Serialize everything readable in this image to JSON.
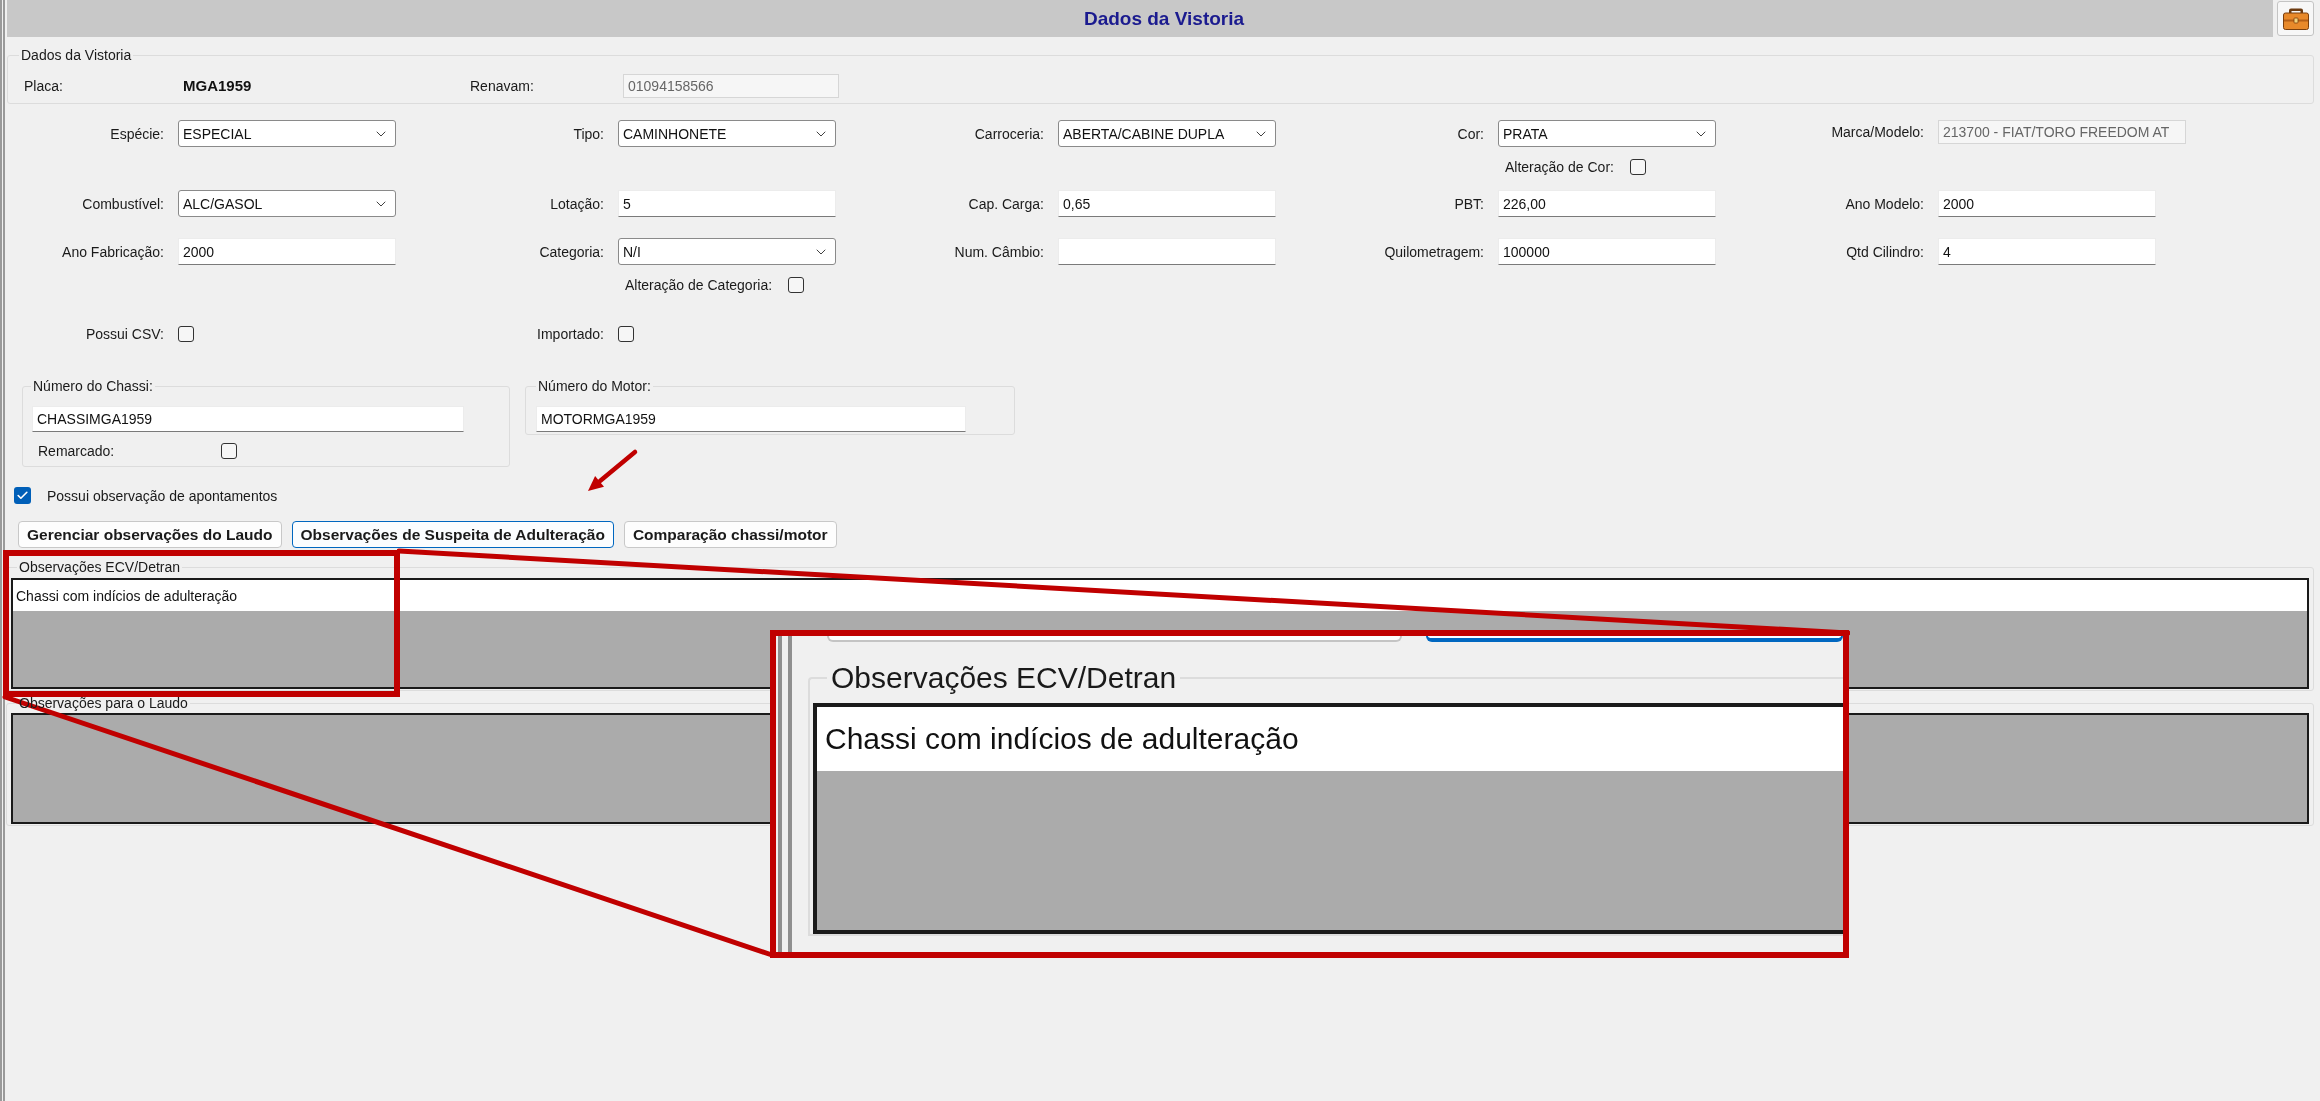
{
  "header": {
    "title": "Dados da Vistoria"
  },
  "vistoria": {
    "legend": "Dados da Vistoria",
    "placa": {
      "label": "Placa:",
      "value": "MGA1959"
    },
    "renavam": {
      "label": "Renavam:",
      "kind": "readonly",
      "value": "01094158566"
    }
  },
  "rows": [
    {
      "cells": [
        {
          "kind": "combo",
          "label": "Espécie:",
          "value": "ESPECIAL"
        },
        {
          "kind": "combo",
          "label": "Tipo:",
          "value": "CAMINHONETE"
        },
        {
          "kind": "combo",
          "label": "Carroceria:",
          "value": "ABERTA/CABINE DUPLA"
        },
        {
          "kind": "combo",
          "label": "Cor:",
          "value": "PRATA",
          "option": {
            "label": "Alteração de Cor:",
            "checked": false
          }
        },
        {
          "kind": "readonly",
          "label": "Marca/Modelo:",
          "value": "213700 - FIAT/TORO FREEDOM AT"
        }
      ]
    },
    {
      "cells": [
        {
          "kind": "combo",
          "label": "Combustível:",
          "value": "ALC/GASOL"
        },
        {
          "kind": "text",
          "label": "Lotação:",
          "value": "5"
        },
        {
          "kind": "text",
          "label": "Cap. Carga:",
          "value": "0,65"
        },
        {
          "kind": "text",
          "label": "PBT:",
          "value": "226,00"
        },
        {
          "kind": "text",
          "label": "Ano Modelo:",
          "value": "2000"
        }
      ]
    },
    {
      "cells": [
        {
          "kind": "text",
          "label": "Ano Fabricação:",
          "value": "2000"
        },
        {
          "kind": "combo",
          "label": "Categoria:",
          "value": "N/I",
          "option": {
            "label": "Alteração de Categoria:",
            "checked": false
          }
        },
        {
          "kind": "text",
          "label": "Num. Câmbio:"
        },
        {
          "kind": "text",
          "label": "Quilometragem:",
          "value": "100000"
        },
        {
          "kind": "text",
          "label": "Qtd Cilindro:",
          "value": "4"
        }
      ]
    },
    {
      "cells": [
        {
          "kind": "checkbox",
          "label": "Possui CSV:",
          "checked": false
        },
        {
          "kind": "checkbox",
          "label": "Importado:",
          "checked": false
        }
      ]
    }
  ],
  "chassi": {
    "legend": "Número do Chassi:",
    "value": "CHASSIMGA1959",
    "option": {
      "label": "Remarcado:",
      "checked": false
    }
  },
  "motor": {
    "legend": "Número do Motor:",
    "value": "MOTORMGA1959"
  },
  "apontamentos": {
    "label": "Possui observação de apontamentos",
    "checked": true
  },
  "buttons": [
    {
      "label": "Gerenciar observações do Laudo",
      "focused": false
    },
    {
      "label": "Observações de Suspeita de Adulteração",
      "focused": true
    },
    {
      "label": "Comparação chassi/motor",
      "focused": false
    }
  ],
  "observacoes_ecv": {
    "legend": "Observações ECV/Detran",
    "rows": [
      "Chassi com indícios de adulteração"
    ]
  },
  "observacoes_laudo": {
    "legend": "Observações para o Laudo"
  },
  "zoom_inset": {
    "legend": "Observações ECV/Detran",
    "rows": [
      "Chassi com indícios de adulteração"
    ]
  }
}
